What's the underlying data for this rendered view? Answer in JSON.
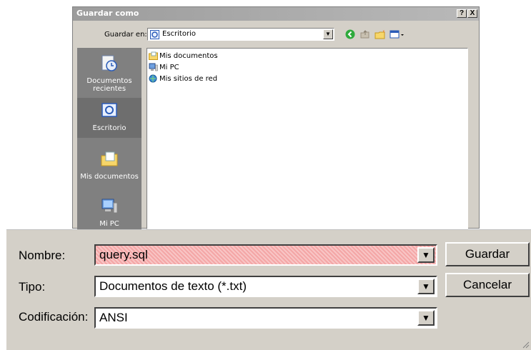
{
  "dialog": {
    "title": "Guardar como",
    "help_label": "?",
    "close_label": "X"
  },
  "lookin": {
    "label": "Guardar en:",
    "value": "Escritorio"
  },
  "places": [
    {
      "label": "Documentos recientes"
    },
    {
      "label": "Escritorio"
    },
    {
      "label": "Mis documentos"
    },
    {
      "label": "Mi PC"
    }
  ],
  "files": [
    {
      "name": "Mis documentos",
      "icon": "documents-folder-icon"
    },
    {
      "name": "Mi PC",
      "icon": "computer-icon"
    },
    {
      "name": "Mis sitios de red",
      "icon": "network-places-icon"
    }
  ],
  "form": {
    "name_label": "Nombre:",
    "name_value": "query.sql",
    "type_label": "Tipo:",
    "type_value": "Documentos de texto (*.txt)",
    "encoding_label": "Codificación:",
    "encoding_value": "ANSI"
  },
  "buttons": {
    "save": "Guardar",
    "cancel": "Cancelar"
  },
  "colors": {
    "dialog_bg": "#d4d0c8",
    "places_bg": "#808080",
    "highlight": "#f4a6a6"
  }
}
